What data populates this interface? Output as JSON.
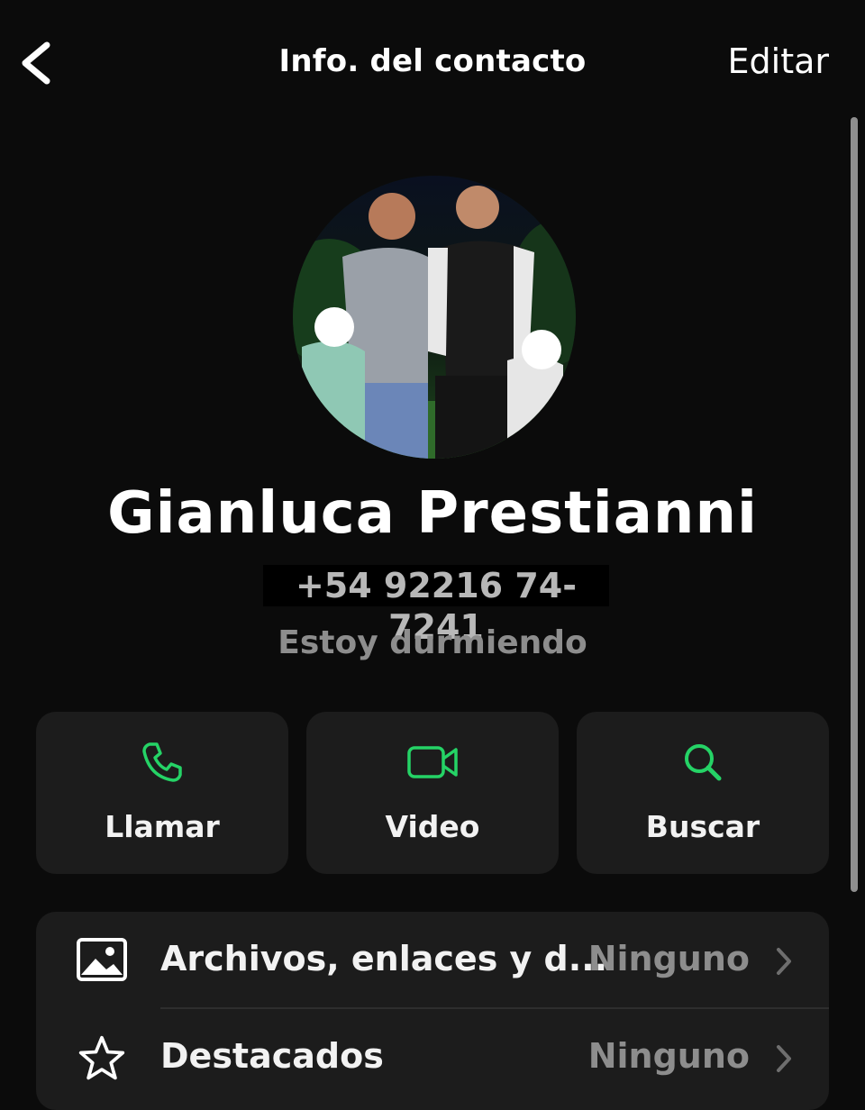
{
  "header": {
    "back_icon": "chevron-left-icon",
    "title": "Info. del contacto",
    "edit_label": "Editar"
  },
  "contact": {
    "name": "Gianluca Prestianni",
    "phone": "+54 92216 74-7241",
    "status": "Estoy durmiendo"
  },
  "actions": [
    {
      "label": "Llamar",
      "icon": "phone-icon"
    },
    {
      "label": "Video",
      "icon": "video-camera-icon"
    },
    {
      "label": "Buscar",
      "icon": "search-icon"
    }
  ],
  "list": [
    {
      "label": "Archivos, enlaces y d...",
      "value": "Ninguno",
      "icon": "image-icon"
    },
    {
      "label": "Destacados",
      "value": "Ninguno",
      "icon": "star-icon"
    }
  ],
  "colors": {
    "background": "#0b0b0b",
    "card": "#1c1c1c",
    "accent_green": "#25d366",
    "muted_text": "#8d8d8d"
  }
}
